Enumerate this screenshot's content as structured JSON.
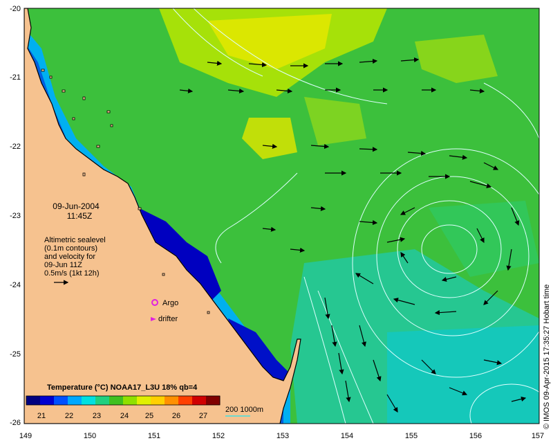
{
  "map": {
    "x_ticks": [
      "149",
      "150",
      "151",
      "152",
      "153",
      "154",
      "155",
      "156",
      "157"
    ],
    "y_ticks": [
      "-20",
      "-21",
      "-22",
      "-23",
      "-24",
      "-25",
      "-26"
    ],
    "land_color": "#f6c28f",
    "coast_color": "#000000",
    "contour_color": "#dfffff"
  },
  "annotations": {
    "date": "09-Jun-2004",
    "time": "11:45Z",
    "altimetry_lines": [
      "Altimetric sealevel",
      "(0.1m contours)",
      "and velocity for",
      "09-Jun 11Z",
      "0.5m/s (1kt 12h)"
    ],
    "argo_label": "Argo",
    "drifter_label": "drifter",
    "argo_color": "#e020e0",
    "drifter_color": "#e020e0",
    "bathy_label": "200  1000m",
    "credit": "© IMOS 09-Apr-2015 17:35:27 Hobart time"
  },
  "colorbar": {
    "title": "Temperature (°C) NOAA17_L3U 18% qb=4",
    "labels": [
      "21",
      "22",
      "23",
      "24",
      "25",
      "26",
      "27"
    ],
    "colors": [
      "#00007f",
      "#0000d0",
      "#0050ff",
      "#00a8ff",
      "#00e0e0",
      "#20d080",
      "#40c020",
      "#90e000",
      "#e0f000",
      "#ffd000",
      "#ff9000",
      "#ff4000",
      "#d00000",
      "#800000"
    ]
  }
}
